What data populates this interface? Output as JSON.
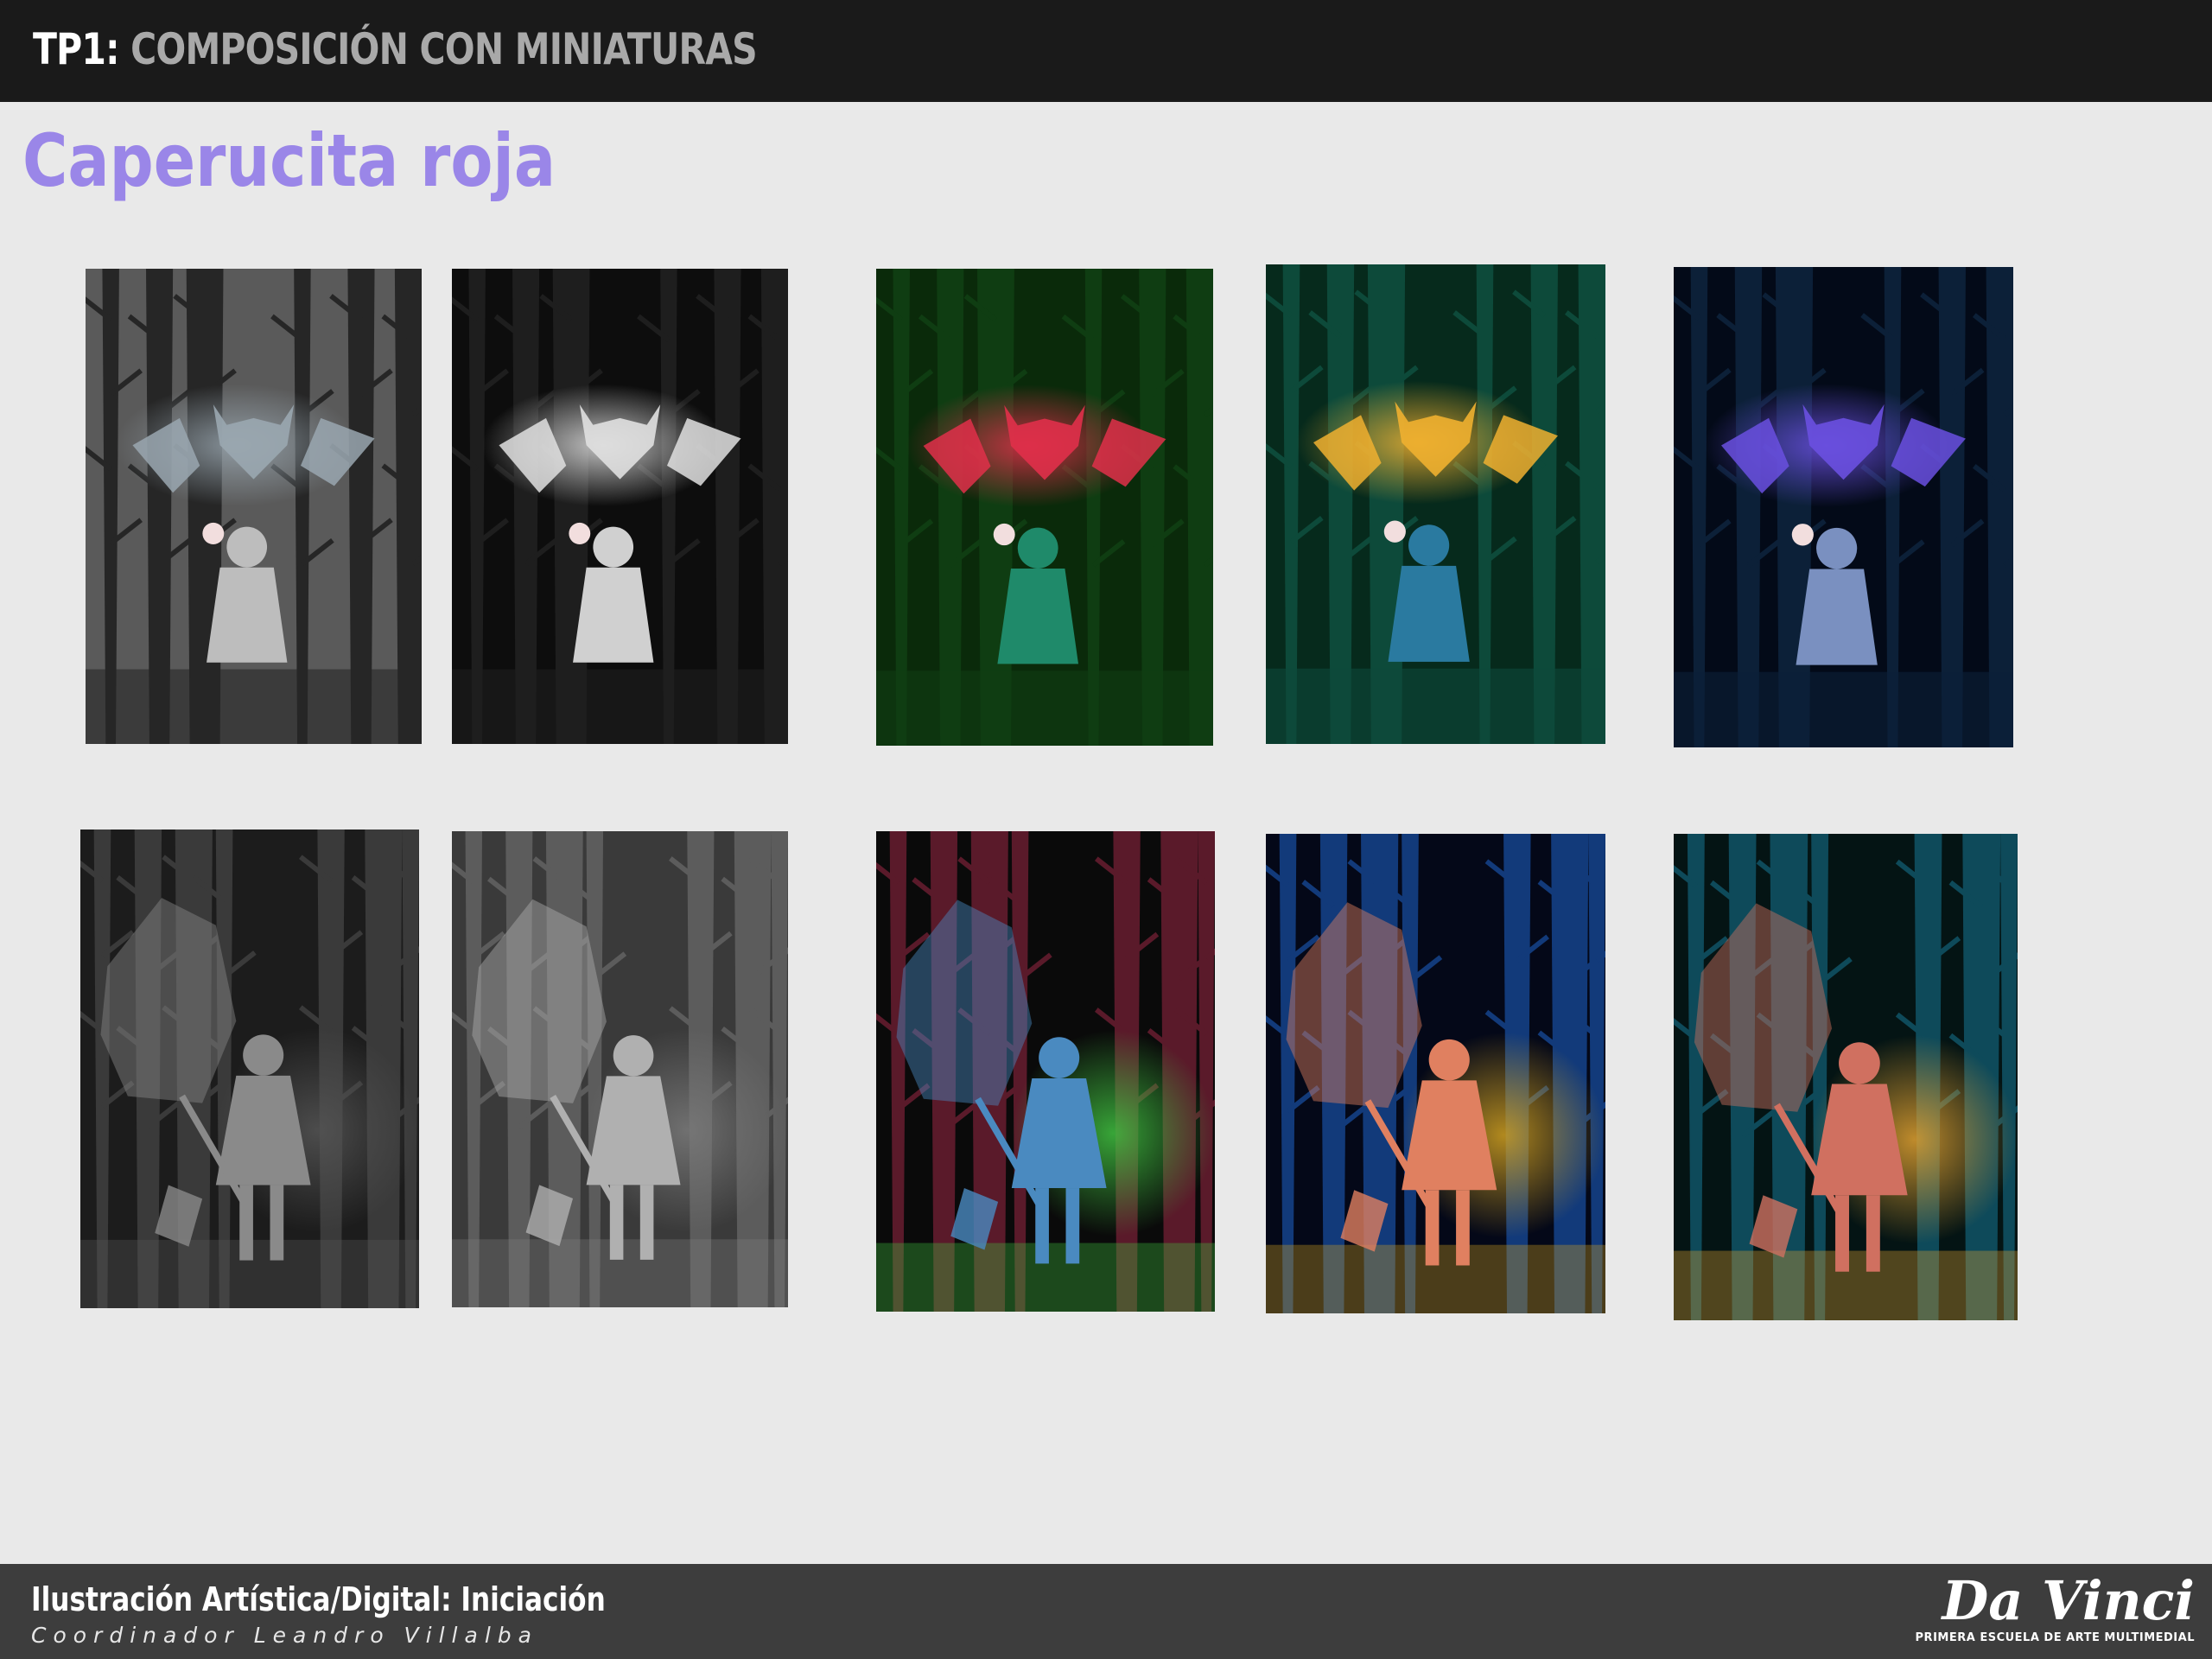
{
  "header": {
    "tp_label": "TP1:",
    "subtitle": "COMPOSICIÓN CON MINIATURAS"
  },
  "title": "Caperucita roja",
  "thumbnails": {
    "row1": [
      {
        "name": "thumb-value-gray",
        "bg": "#5a5a5a",
        "tree": "#262626",
        "figure": "#bdbdbd",
        "glow": "#9aa7b0"
      },
      {
        "name": "thumb-value-dark",
        "bg": "#0d0d0d",
        "tree": "#1e1e1e",
        "figure": "#d0d0d0",
        "glow": "#e0e0e0"
      },
      {
        "name": "thumb-color-red",
        "bg": "#0a2a0a",
        "tree": "#0f3d12",
        "figure": "#1f8a6a",
        "glow": "#e0304a"
      },
      {
        "name": "thumb-color-yellow",
        "bg": "#062a1c",
        "tree": "#0d4a3a",
        "figure": "#2a7aa0",
        "glow": "#f0b030"
      },
      {
        "name": "thumb-color-blue",
        "bg": "#030a18",
        "tree": "#0c2038",
        "figure": "#7a90c0",
        "glow": "#6a50e0"
      }
    ],
    "row2": [
      {
        "name": "thumb-wolf-value-dark",
        "bg": "#1c1c1c",
        "tree": "#3a3a3a",
        "figure": "#8a8a8a",
        "glow": "#555555"
      },
      {
        "name": "thumb-wolf-value-gray",
        "bg": "#3a3a3a",
        "tree": "#5c5c5c",
        "figure": "#b0b0b0",
        "glow": "#7a7a7a"
      },
      {
        "name": "thumb-wolf-color-magenta",
        "bg": "#0a0a0a",
        "tree": "#5a1a2a",
        "figure": "#4a8ac0",
        "glow": "#40c040"
      },
      {
        "name": "thumb-wolf-color-blue",
        "bg": "#040818",
        "tree": "#123a7a",
        "figure": "#e08060",
        "glow": "#d0a020"
      },
      {
        "name": "thumb-wolf-color-teal",
        "bg": "#041414",
        "tree": "#0e4a5a",
        "figure": "#d07060",
        "glow": "#e0a030"
      }
    ]
  },
  "footer": {
    "course": "Ilustración Artística/Digital: Iniciación",
    "coordinator": "Coordinador Leandro Villalba",
    "logo_text": "Da Vinci",
    "logo_tagline": "PRIMERA ESCUELA DE ARTE MULTIMEDIAL"
  }
}
